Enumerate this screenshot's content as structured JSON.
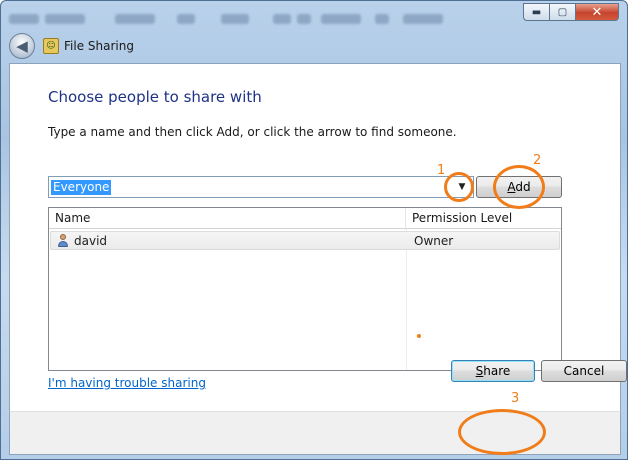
{
  "window": {
    "title": "File Sharing",
    "controls": {
      "minimize": "▬",
      "maximize": "▢",
      "close": "✕"
    },
    "back_glyph": "◀"
  },
  "heading": "Choose people to share with",
  "instructions": "Type a name and then click Add, or click the arrow to find someone.",
  "name_input": {
    "value": "Everyone",
    "dropdown_glyph": "▼"
  },
  "add_button": {
    "pre": "",
    "access_key": "A",
    "post": "dd"
  },
  "list": {
    "columns": [
      "Name",
      "Permission Level"
    ],
    "rows": [
      {
        "name": "david",
        "permission": "Owner"
      }
    ]
  },
  "trouble_link": "I'm having trouble sharing",
  "footer": {
    "share_button": {
      "access_key": "S",
      "post": "hare"
    },
    "cancel_button": "Cancel"
  },
  "annotations": [
    "1",
    "2",
    "3"
  ],
  "icons": [
    "back-arrow-icon",
    "file-sharing-icon",
    "dropdown-arrow-icon",
    "user-icon"
  ],
  "colors": {
    "annotation": "#f07d1a",
    "heading": "#1e3287",
    "link": "#0066cc",
    "selection": "#3399ff"
  }
}
